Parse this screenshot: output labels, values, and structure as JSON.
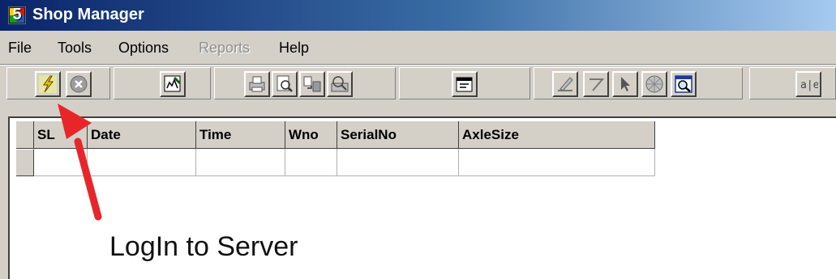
{
  "window": {
    "title": "Shop Manager",
    "icon_label": "5"
  },
  "menu": {
    "items": [
      {
        "label": "File",
        "enabled": true
      },
      {
        "label": "Tools",
        "enabled": true
      },
      {
        "label": "Options",
        "enabled": true
      },
      {
        "label": "Reports",
        "enabled": false
      },
      {
        "label": "Help",
        "enabled": true
      }
    ]
  },
  "toolbar": {
    "buttons": [
      {
        "icon": "lightning-login-icon"
      },
      {
        "icon": "close-circle-icon"
      },
      {
        "icon": "edit-document-icon"
      },
      {
        "icon": "print-icon"
      },
      {
        "icon": "print-preview-icon"
      },
      {
        "icon": "transfer-icon"
      },
      {
        "icon": "search-tools-icon"
      },
      {
        "icon": "properties-icon"
      },
      {
        "icon": "edit-pencil-icon"
      },
      {
        "icon": "eraser-icon"
      },
      {
        "icon": "pointer-icon"
      },
      {
        "icon": "globe-icon"
      },
      {
        "icon": "zoom-window-icon"
      },
      {
        "icon": "spell-check-icon"
      }
    ]
  },
  "grid": {
    "columns": [
      "SL",
      "Date",
      "Time",
      "Wno",
      "SerialNo",
      "AxleSize"
    ],
    "rows": [
      [
        "",
        "",
        "",
        "",
        "",
        ""
      ]
    ]
  },
  "annotation": {
    "text": "LogIn to Server",
    "arrow_color": "#e8262a"
  },
  "colors": {
    "titlebar_start": "#0a246a",
    "titlebar_end": "#a6caf0",
    "face": "#d4d0c8"
  }
}
